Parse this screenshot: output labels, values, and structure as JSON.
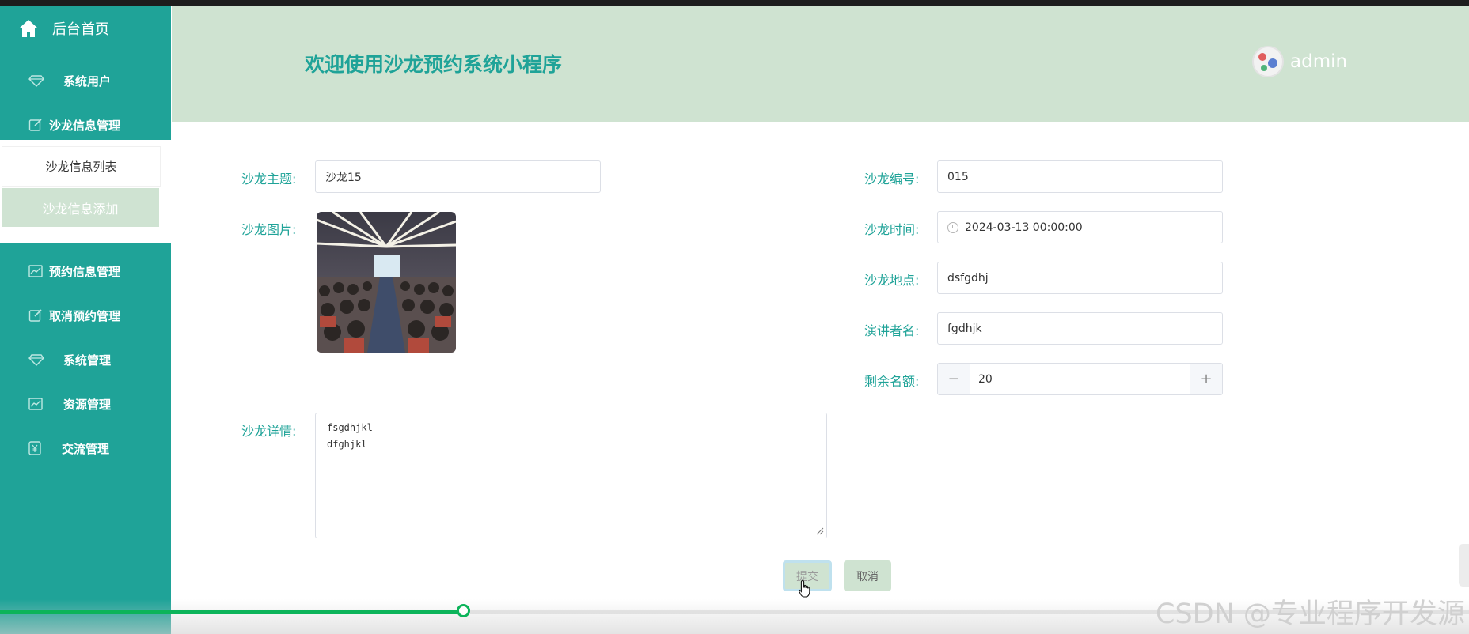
{
  "sidebar": {
    "home_label": "后台首页",
    "items": [
      {
        "label": "系统用户",
        "icon": "diamond-icon"
      },
      {
        "label": "沙龙信息管理",
        "icon": "edit-icon"
      },
      {
        "label": "预约信息管理",
        "icon": "chart-icon"
      },
      {
        "label": "取消预约管理",
        "icon": "edit-icon"
      },
      {
        "label": "系统管理",
        "icon": "diamond-icon"
      },
      {
        "label": "资源管理",
        "icon": "chart-icon"
      },
      {
        "label": "交流管理",
        "icon": "yen-icon"
      }
    ],
    "submenu": [
      "沙龙信息列表",
      "沙龙信息添加"
    ]
  },
  "header": {
    "title": "欢迎使用沙龙预约系统小程序",
    "username": "admin"
  },
  "form": {
    "theme": {
      "label": "沙龙主题:",
      "value": "沙龙15"
    },
    "number": {
      "label": "沙龙编号:",
      "value": "015"
    },
    "image": {
      "label": "沙龙图片:"
    },
    "time": {
      "label": "沙龙时间:",
      "value": "2024-03-13 00:00:00"
    },
    "location": {
      "label": "沙龙地点:",
      "value": "dsfgdhj"
    },
    "speaker": {
      "label": "演讲者名:",
      "value": "fgdhjk"
    },
    "quota": {
      "label": "剩余名额:",
      "value": "20",
      "minus": "−",
      "plus": "+"
    },
    "detail": {
      "label": "沙龙详情:",
      "value": "fsgdhjkl\ndfghjkl"
    },
    "submit_label": "提交",
    "cancel_label": "取消"
  },
  "video": {
    "progress": 0.35
  },
  "watermark": "CSDN @专业程序开发源",
  "colors": {
    "primary": "#1fa398",
    "header_bg": "#cfe3d1",
    "progress": "#0cb45a"
  }
}
